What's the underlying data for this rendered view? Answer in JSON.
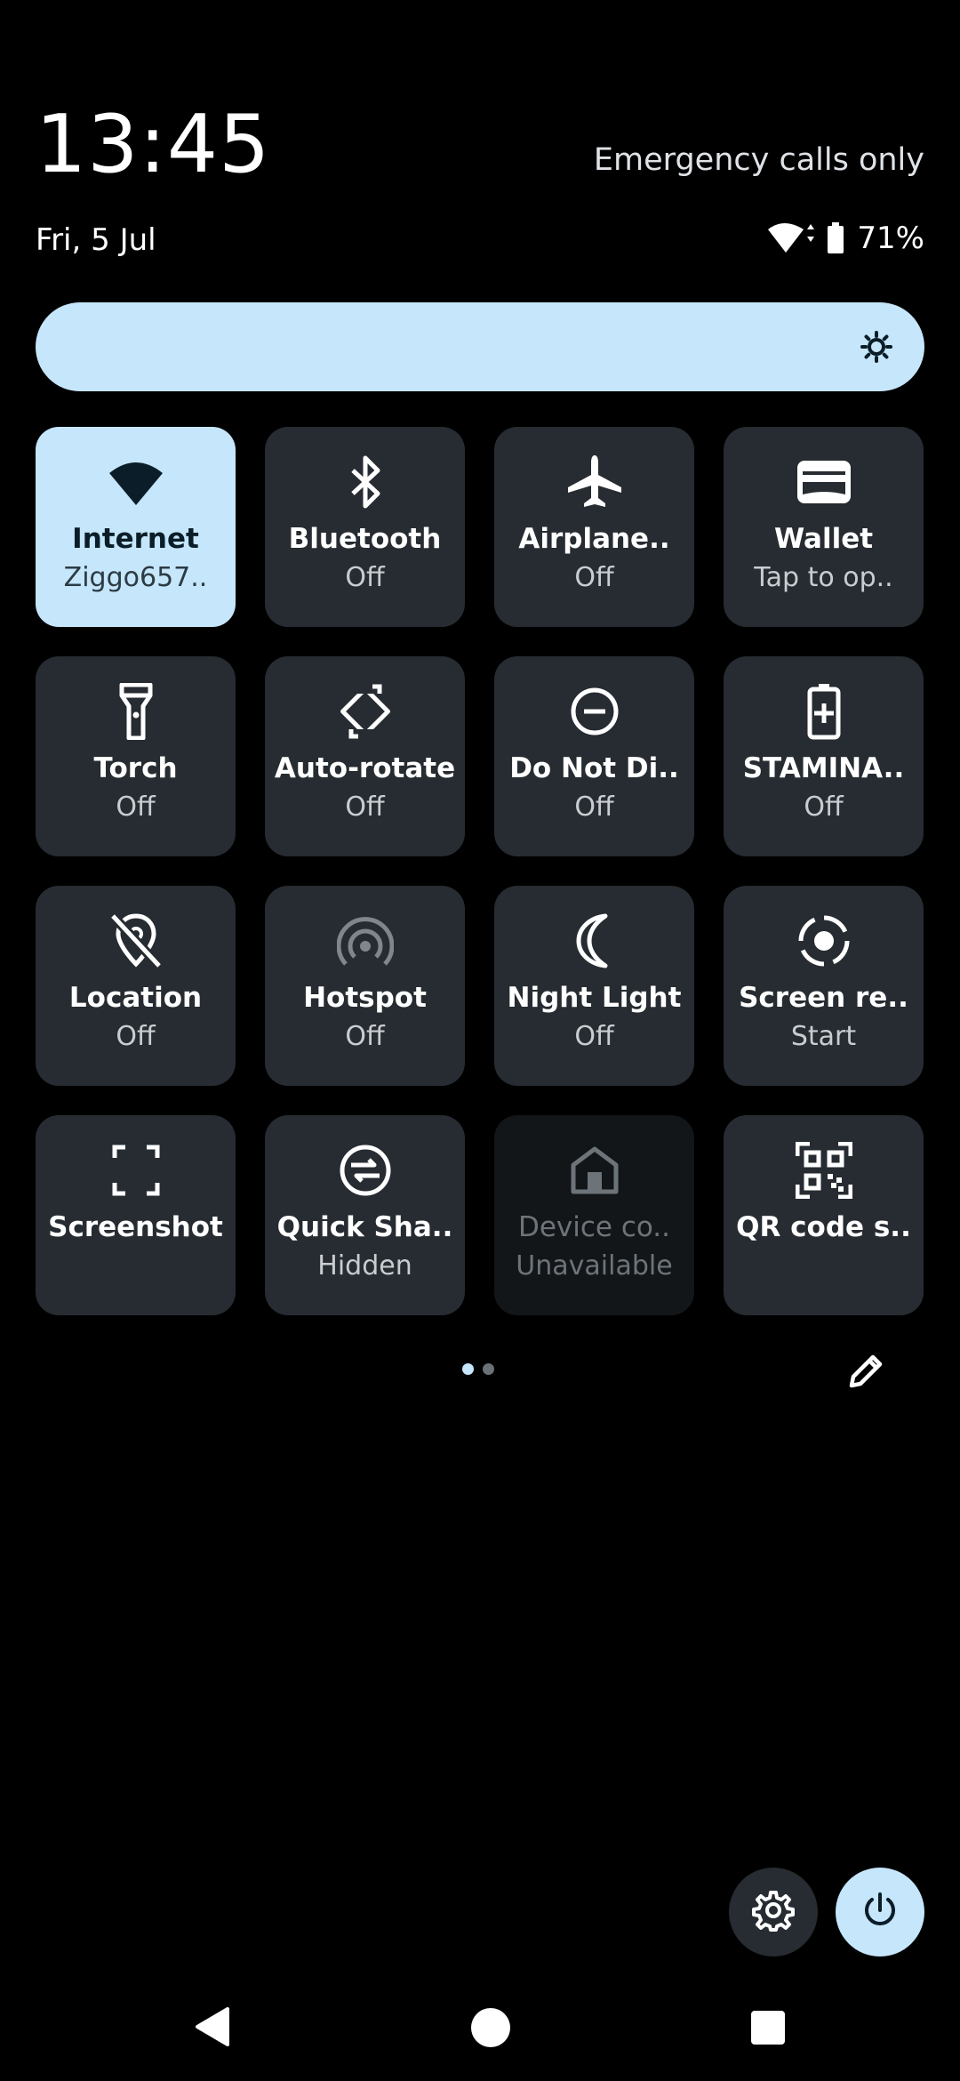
{
  "header": {
    "clock": "13:45",
    "date": "Fri, 5 Jul",
    "carrier_status": "Emergency calls only",
    "battery_percent": "71%"
  },
  "brightness": {
    "icon": "brightness-icon",
    "accent": "#c5e6fb"
  },
  "tiles": [
    {
      "label": "Internet",
      "sub": "Ziggo657..",
      "icon": "wifi-icon",
      "state": "on"
    },
    {
      "label": "Bluetooth",
      "sub": "Off",
      "icon": "bluetooth-icon",
      "state": "off"
    },
    {
      "label": "Airplane..",
      "sub": "Off",
      "icon": "airplane-icon",
      "state": "off"
    },
    {
      "label": "Wallet",
      "sub": "Tap to op..",
      "icon": "wallet-icon",
      "state": "off"
    },
    {
      "label": "Torch",
      "sub": "Off",
      "icon": "torch-icon",
      "state": "off"
    },
    {
      "label": "Auto-rotate",
      "sub": "Off",
      "icon": "rotate-icon",
      "state": "off"
    },
    {
      "label": "Do Not Di..",
      "sub": "Off",
      "icon": "do-not-disturb-icon",
      "state": "off"
    },
    {
      "label": "STAMINA..",
      "sub": "Off",
      "icon": "battery-plus-icon",
      "state": "off"
    },
    {
      "label": "Location",
      "sub": "Off",
      "icon": "location-off-icon",
      "state": "off"
    },
    {
      "label": "Hotspot",
      "sub": "Off",
      "icon": "hotspot-icon",
      "state": "off"
    },
    {
      "label": "Night Light",
      "sub": "Off",
      "icon": "moon-icon",
      "state": "off"
    },
    {
      "label": "Screen re..",
      "sub": "Start",
      "icon": "screen-record-icon",
      "state": "off"
    },
    {
      "label": "Screenshot",
      "sub": "",
      "icon": "screenshot-icon",
      "state": "off"
    },
    {
      "label": "Quick Sha..",
      "sub": "Hidden",
      "icon": "quick-share-icon",
      "state": "off"
    },
    {
      "label": "Device co..",
      "sub": "Unavailable",
      "icon": "home-icon",
      "state": "unavailable"
    },
    {
      "label": "QR code s..",
      "sub": "",
      "icon": "qr-code-icon",
      "state": "off"
    }
  ],
  "pager": {
    "pages": 2,
    "current": 1
  },
  "footer": {
    "settings_icon": "gear-icon",
    "power_icon": "power-icon",
    "edit_icon": "pencil-icon"
  },
  "colors": {
    "tile_bg": "#262c31",
    "tile_active": "#c5e6fb",
    "tile_unavailable": "#131618"
  }
}
